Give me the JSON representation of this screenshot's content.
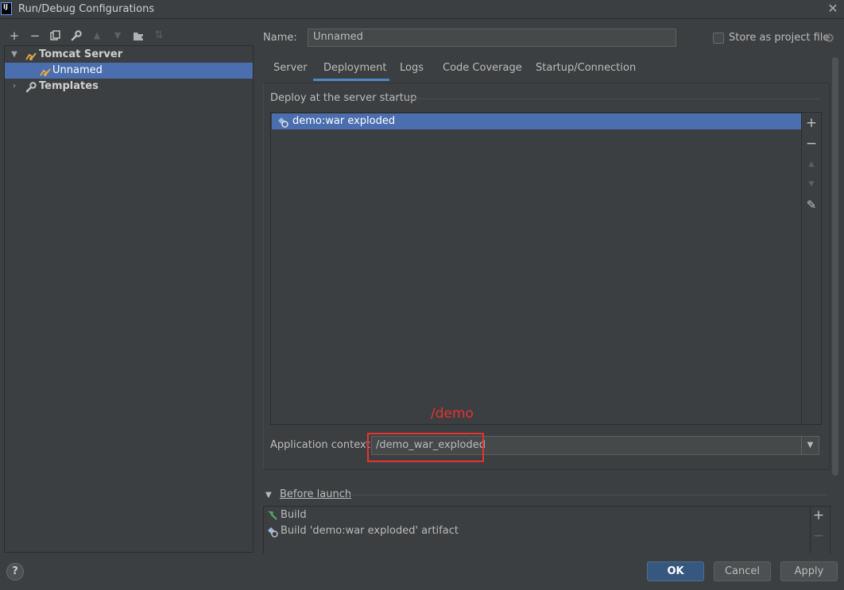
{
  "window": {
    "title": "Run/Debug Configurations",
    "logo": "IJ",
    "close": "✕"
  },
  "toolbar": {
    "add": "+",
    "remove": "−",
    "copy": "⧉",
    "edit_defaults": "🔧",
    "move_up": "▲",
    "move_down": "▼",
    "new_folder": "📁",
    "sort": "⇅"
  },
  "tree": {
    "items": [
      {
        "label": "Tomcat Server",
        "expanded": true,
        "bold": true
      },
      {
        "label": "Unnamed",
        "selected": true
      },
      {
        "label": "Templates",
        "expanded": false,
        "bold": true
      }
    ]
  },
  "config": {
    "name_label": "Name:",
    "name_value": "Unnamed",
    "store_label": "Store as project file",
    "store_checked": false
  },
  "tabs": [
    "Server",
    "Deployment",
    "Logs",
    "Code Coverage",
    "Startup/Connection"
  ],
  "active_tab": "Deployment",
  "deployment": {
    "legend": "Deploy at the server startup",
    "items": [
      "demo:war exploded"
    ],
    "tools": {
      "add": "+",
      "remove": "−",
      "up": "▲",
      "down": "▼",
      "edit": "✎"
    },
    "context_label": "Application context:",
    "context_value": "/demo_war_exploded",
    "annotation": "/demo",
    "dropdown": "▼"
  },
  "before_launch": {
    "label": "Before launch",
    "items": [
      "Build",
      "Build 'demo:war exploded' artifact"
    ],
    "tools": {
      "add": "+",
      "remove": "−"
    }
  },
  "buttons": {
    "ok": "OK",
    "cancel": "Cancel",
    "apply": "Apply",
    "help": "?"
  },
  "colors": {
    "selection": "#4b6eaf",
    "accent": "#4a88c7",
    "annotation": "#e8322e",
    "ok_button": "#365880"
  }
}
